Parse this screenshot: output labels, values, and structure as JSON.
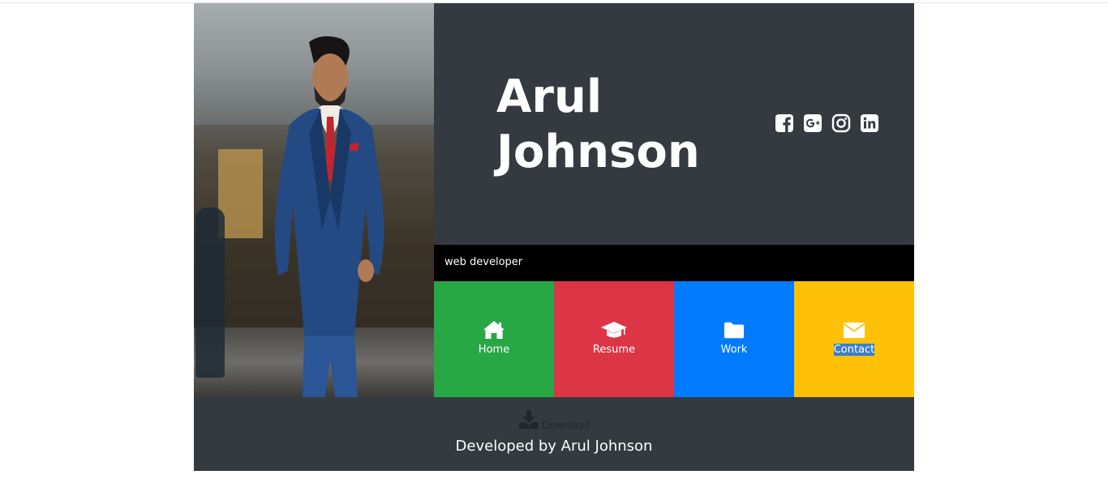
{
  "profile": {
    "name": "Arul\nJohnson",
    "title": "web developer"
  },
  "socials": [
    {
      "name": "facebook",
      "icon": "facebook-icon"
    },
    {
      "name": "google-plus",
      "icon": "google-plus-icon"
    },
    {
      "name": "instagram",
      "icon": "instagram-icon"
    },
    {
      "name": "linkedin",
      "icon": "linkedin-icon"
    }
  ],
  "nav": {
    "home": {
      "label": "Home",
      "icon": "home-icon",
      "color": "#28a745"
    },
    "resume": {
      "label": "Resume",
      "icon": "graduation-cap-icon",
      "color": "#dc3545"
    },
    "work": {
      "label": "Work",
      "icon": "folder-icon",
      "color": "#007bff"
    },
    "contact": {
      "label": "Contact",
      "icon": "envelope-icon",
      "color": "#ffc107"
    }
  },
  "footer": {
    "download_label": "Download",
    "credit": "Developed by Arul Johnson"
  },
  "colors": {
    "panel": "#343a40",
    "tagline_bg": "#000000",
    "text": "#ffffff"
  }
}
